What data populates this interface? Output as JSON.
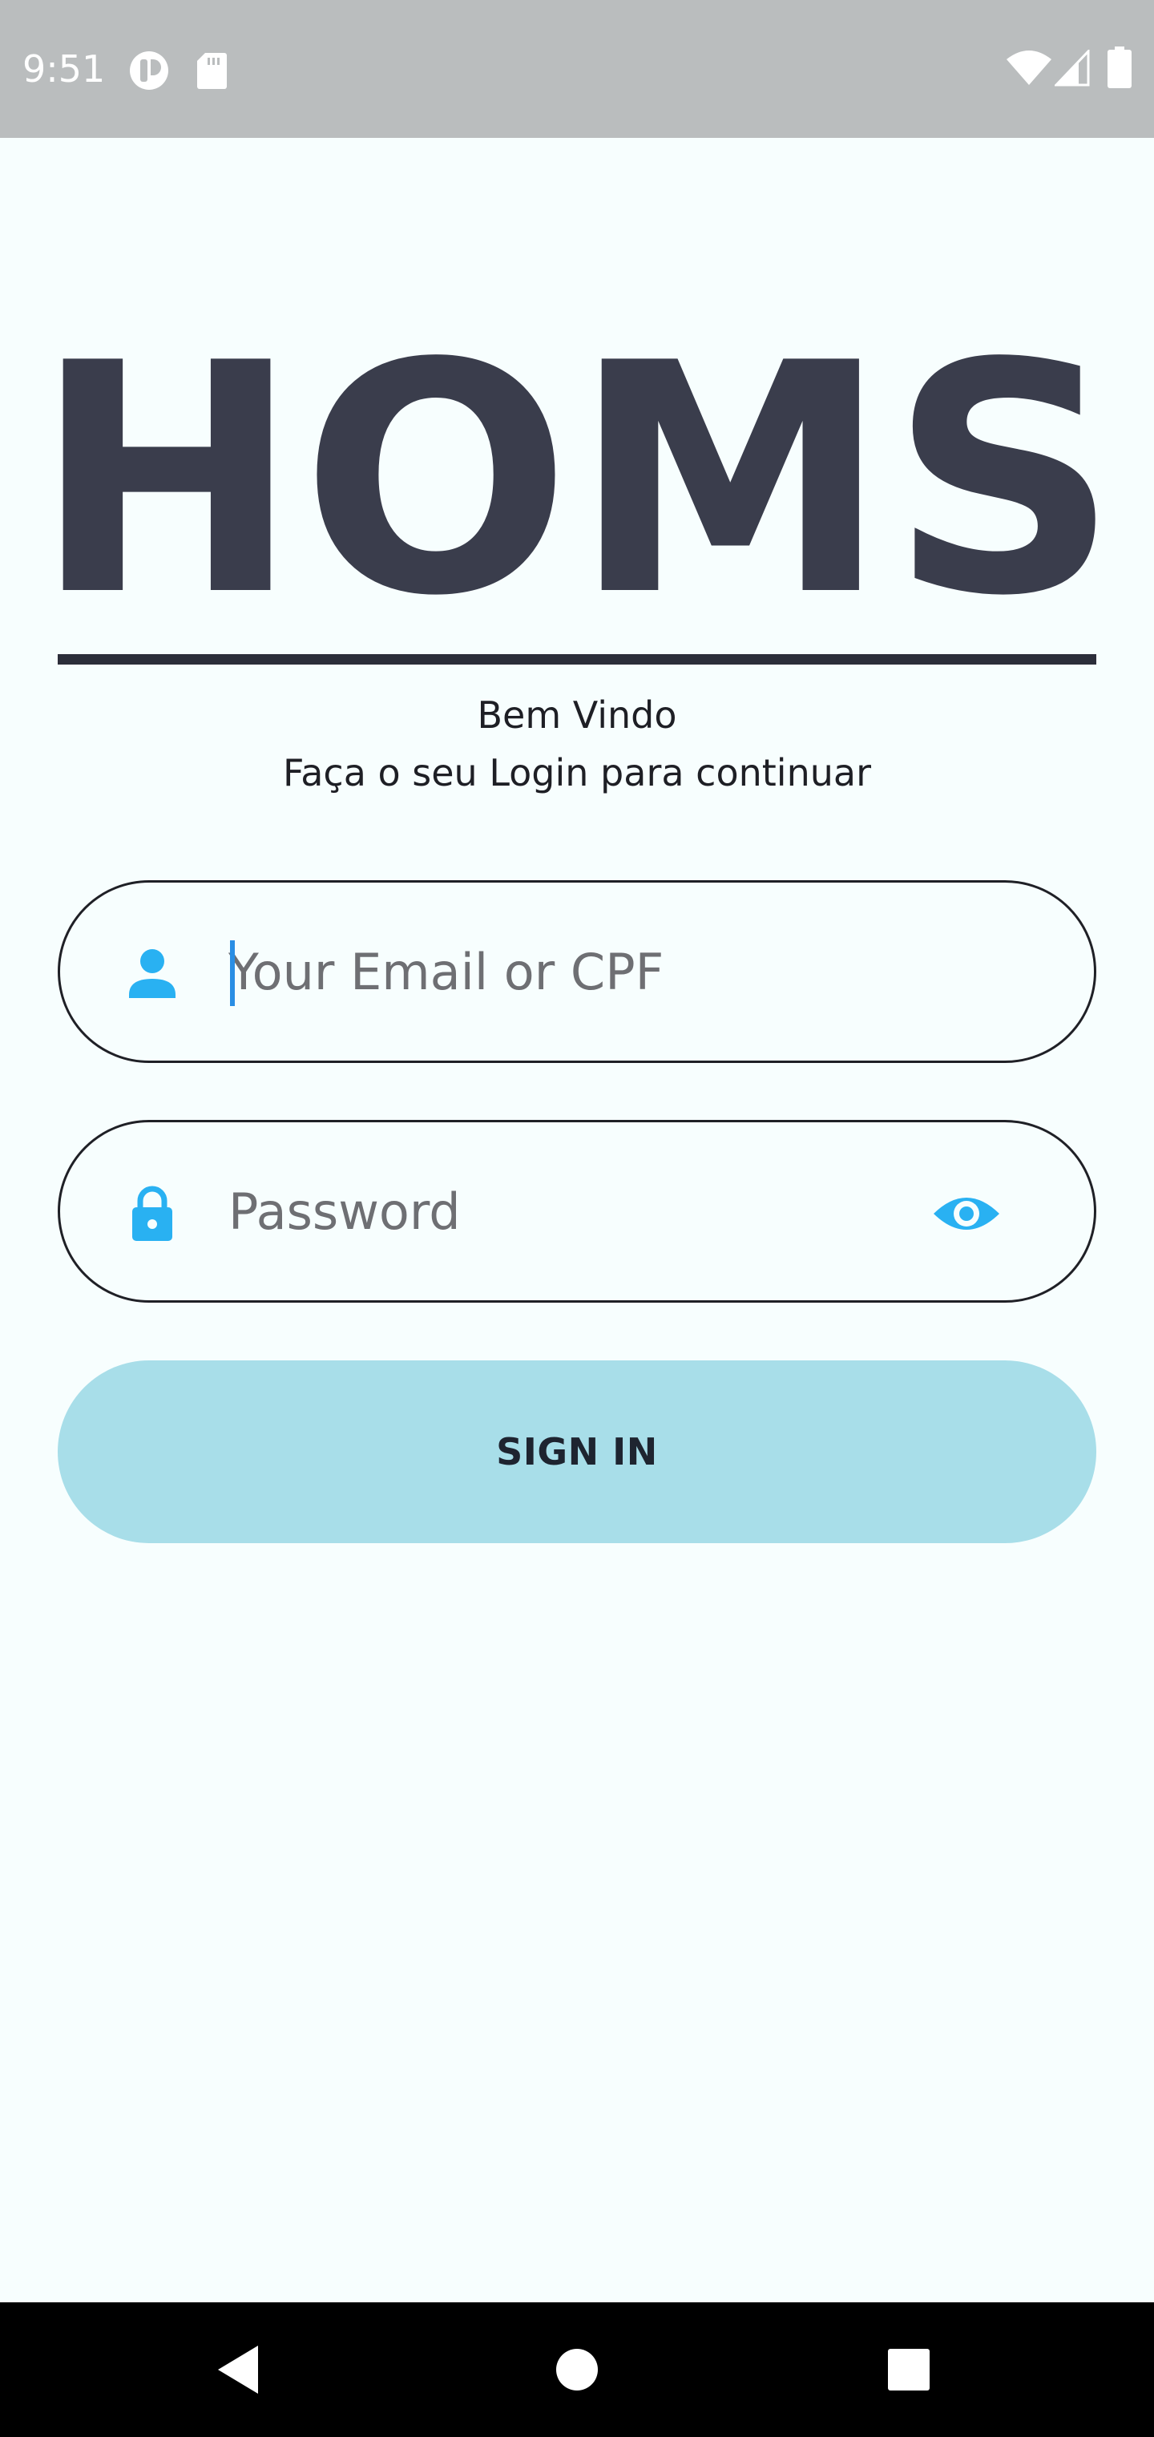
{
  "status_bar": {
    "time": "9:51",
    "icons": [
      "app-notification-icon",
      "sd-card-icon",
      "wifi-icon",
      "cell-signal-icon",
      "battery-icon"
    ]
  },
  "brand": {
    "logo_text": "HOMS"
  },
  "welcome": {
    "title": "Bem Vindo",
    "subtitle": "Faça o seu Login para continuar"
  },
  "email_field": {
    "placeholder": "Your Email or CPF",
    "value": "",
    "icon": "user-icon"
  },
  "password_field": {
    "placeholder": "Password",
    "value": "",
    "icon": "lock-icon",
    "toggle_icon": "eye-icon"
  },
  "sign_in": {
    "label": "SIGN IN"
  },
  "nav_bar": {
    "buttons": [
      "back-icon",
      "home-icon",
      "recents-icon"
    ]
  },
  "colors": {
    "background": "#f7fefe",
    "status_bar": "#babdbe",
    "logo": "#3a3d4c",
    "accent_icon": "#29b1f2",
    "button": "#a8dee9",
    "caret": "#2a8ee4"
  }
}
